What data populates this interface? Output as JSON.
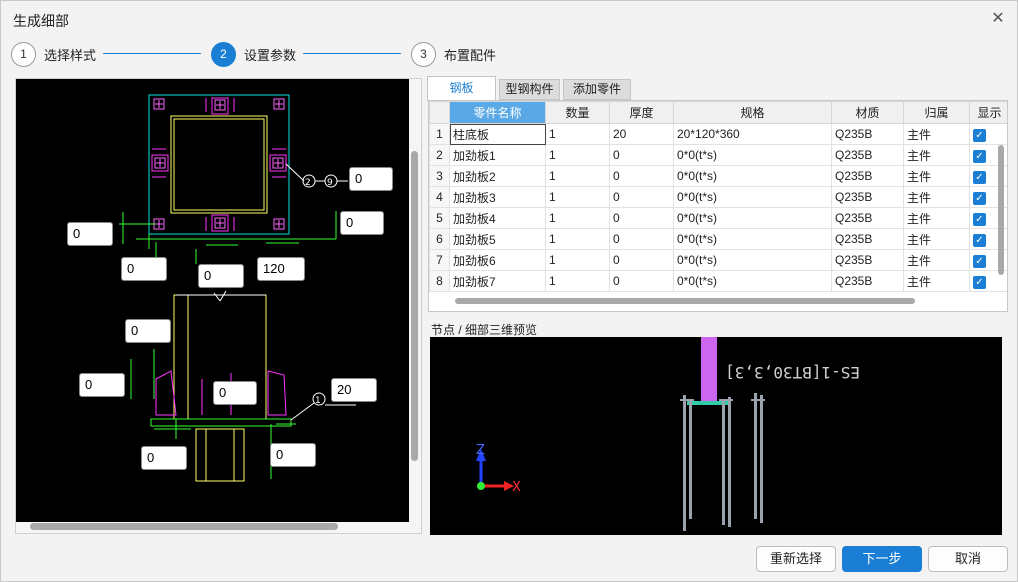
{
  "window": {
    "title": "生成细部",
    "close_icon": "close-icon"
  },
  "steps": [
    {
      "number": "1",
      "label": "选择样式",
      "active": false
    },
    {
      "number": "2",
      "label": "设置参数",
      "active": true
    },
    {
      "number": "3",
      "label": "布置配件",
      "active": false
    }
  ],
  "cad": {
    "params": [
      "0",
      "0",
      "0",
      "0",
      "120",
      "0",
      "0",
      "0",
      "20",
      "0",
      "0"
    ],
    "callouts": {
      "top": "②-⑨",
      "bottom": "①"
    }
  },
  "tabs": [
    "钢板",
    "型钢构件",
    "添加零件"
  ],
  "table": {
    "headers": [
      "",
      "零件名称",
      "数量",
      "厚度",
      "规格",
      "材质",
      "归属",
      "显示"
    ],
    "rows": [
      {
        "idx": "1",
        "name": "柱底板",
        "qty": "1",
        "thick": "20",
        "spec": "20*120*360",
        "material": "Q235B",
        "owner": "主件",
        "show": true
      },
      {
        "idx": "2",
        "name": "加劲板1",
        "qty": "1",
        "thick": "0",
        "spec": "0*0(t*s)",
        "material": "Q235B",
        "owner": "主件",
        "show": true
      },
      {
        "idx": "3",
        "name": "加劲板2",
        "qty": "1",
        "thick": "0",
        "spec": "0*0(t*s)",
        "material": "Q235B",
        "owner": "主件",
        "show": true
      },
      {
        "idx": "4",
        "name": "加劲板3",
        "qty": "1",
        "thick": "0",
        "spec": "0*0(t*s)",
        "material": "Q235B",
        "owner": "主件",
        "show": true
      },
      {
        "idx": "5",
        "name": "加劲板4",
        "qty": "1",
        "thick": "0",
        "spec": "0*0(t*s)",
        "material": "Q235B",
        "owner": "主件",
        "show": true
      },
      {
        "idx": "6",
        "name": "加劲板5",
        "qty": "1",
        "thick": "0",
        "spec": "0*0(t*s)",
        "material": "Q235B",
        "owner": "主件",
        "show": true
      },
      {
        "idx": "7",
        "name": "加劲板6",
        "qty": "1",
        "thick": "0",
        "spec": "0*0(t*s)",
        "material": "Q235B",
        "owner": "主件",
        "show": true
      },
      {
        "idx": "8",
        "name": "加劲板7",
        "qty": "1",
        "thick": "0",
        "spec": "0*0(t*s)",
        "material": "Q235B",
        "owner": "主件",
        "show": true
      }
    ]
  },
  "preview": {
    "label": "节点 / 细部三维预览",
    "overlay_text": "ES-1[BT30,3,3]",
    "axis_z": "Z",
    "axis_x": "X"
  },
  "buttons": {
    "reselect": "重新选择",
    "next": "下一步",
    "cancel": "取消"
  },
  "colors": {
    "accent": "#1a7fd4",
    "cad_bg": "#000000",
    "cyan": "#00e5e5",
    "magenta": "#ff33ff",
    "yellow": "#ffff66",
    "green": "#33ff33"
  }
}
